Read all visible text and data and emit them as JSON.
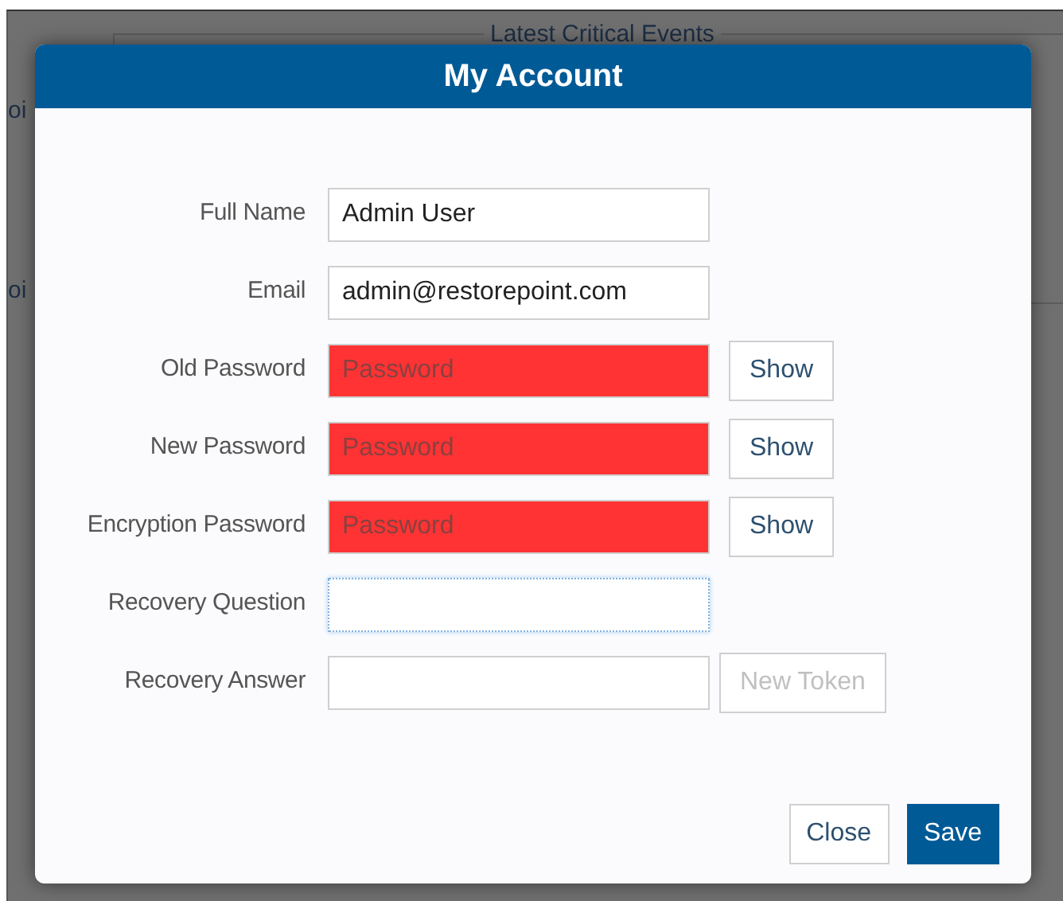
{
  "background": {
    "panel_title": "Latest Critical Events",
    "side_fragments": [
      "oi",
      "oi"
    ]
  },
  "dialog": {
    "title": "My Account",
    "fields": [
      {
        "label": "Full Name",
        "kind": "text",
        "value": "Admin User",
        "invalid": false,
        "focused": false
      },
      {
        "label": "Email",
        "kind": "text",
        "value": "admin@restorepoint.com",
        "invalid": false,
        "focused": false
      },
      {
        "label": "Old Password",
        "kind": "password",
        "placeholder": "Password",
        "invalid": true,
        "focused": false,
        "action": {
          "label": "Show",
          "disabled": false
        }
      },
      {
        "label": "New Password",
        "kind": "password",
        "placeholder": "Password",
        "invalid": true,
        "focused": false,
        "action": {
          "label": "Show",
          "disabled": false
        }
      },
      {
        "label": "Encryption Password",
        "kind": "password",
        "placeholder": "Password",
        "invalid": true,
        "focused": false,
        "action": {
          "label": "Show",
          "disabled": false
        }
      },
      {
        "label": "Recovery Question",
        "kind": "text",
        "invalid": false,
        "focused": true
      },
      {
        "label": "Recovery Answer",
        "kind": "text",
        "invalid": false,
        "focused": false,
        "action": {
          "label": "New Token",
          "disabled": true
        }
      }
    ],
    "buttons": [
      {
        "label": "Close",
        "kind": "secondary"
      },
      {
        "label": "Save",
        "kind": "primary"
      }
    ]
  }
}
